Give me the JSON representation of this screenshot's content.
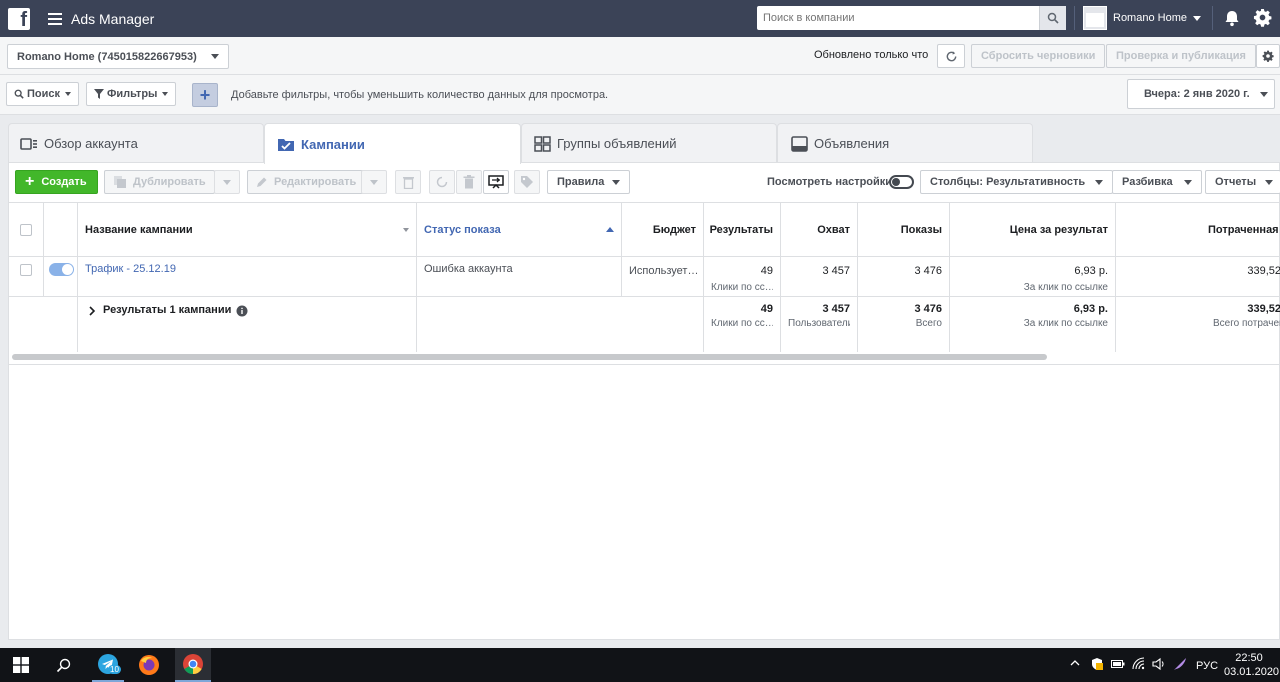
{
  "app": {
    "title": "Ads Manager",
    "logo": "f"
  },
  "topbar": {
    "search_placeholder": "Поиск в компании",
    "account_name": "Romano Home"
  },
  "account_bar": {
    "account_selector": "Romano Home (745015822667953)",
    "updated_text": "Обновлено только что",
    "discard_drafts": "Сбросить черновики",
    "review_publish": "Проверка и публикация"
  },
  "filter_bar": {
    "search_label": "Поиск",
    "filters_label": "Фильтры",
    "hint": "Добавьте фильтры, чтобы уменьшить количество данных для просмотра.",
    "date_range": "Вчера: 2 янв 2020 г."
  },
  "tabs": [
    {
      "label": "Обзор аккаунта",
      "icon": "account-overview-icon",
      "active": false
    },
    {
      "label": "Кампании",
      "icon": "folder-icon",
      "active": true
    },
    {
      "label": "Группы объявлений",
      "icon": "grid-icon",
      "active": false
    },
    {
      "label": "Объявления",
      "icon": "ad-icon",
      "active": false
    }
  ],
  "toolbar": {
    "create": "Создать",
    "duplicate": "Дублировать",
    "edit": "Редактировать",
    "rules": "Правила",
    "view_settings": "Посмотреть настройки",
    "columns": "Столбцы: Результативность",
    "breakdown": "Разбивка",
    "reports": "Отчеты"
  },
  "table": {
    "headers": {
      "name": "Название кампании",
      "status": "Статус показа",
      "budget": "Бюджет",
      "results": "Результаты",
      "reach": "Охват",
      "impressions": "Показы",
      "cost_per_result": "Цена за результат",
      "amount_spent": "Потраченная сумма"
    },
    "row": {
      "name": "Трафик - 25.12.19",
      "status": "Ошибка аккаунта",
      "budget": "Использует…",
      "results": "49",
      "results_sub": "Клики по сс…",
      "reach": "3 457",
      "impressions": "3 476",
      "cost_per_result": "6,93 р.",
      "cost_sub": "За клик по ссылке",
      "amount_spent": "339,52"
    },
    "summary": {
      "label": "Результаты 1 кампании",
      "results": "49",
      "results_sub": "Клики по сс…",
      "reach": "3 457",
      "reach_sub": "Пользователи",
      "impressions": "3 476",
      "impressions_sub": "Всего",
      "cost_per_result": "6,93 р.",
      "cost_sub": "За клик по ссылке",
      "amount_spent": "339,52",
      "spent_sub": "Всего потрачено"
    }
  },
  "taskbar": {
    "lang": "РУС",
    "time": "22:50",
    "date": "03.01.2020",
    "telegram_badge": "10"
  }
}
